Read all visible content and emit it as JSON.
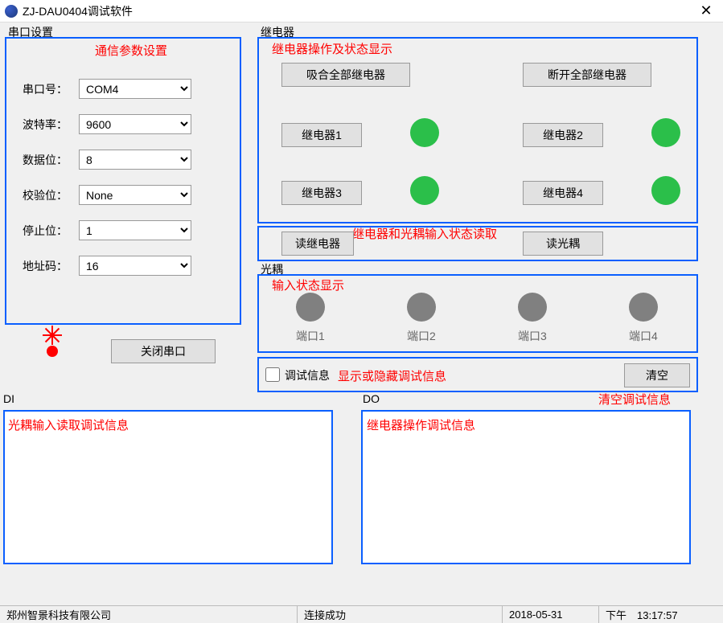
{
  "window": {
    "title": "ZJ-DAU0404调试软件"
  },
  "serial": {
    "group": "串口设置",
    "annot": "通信参数设置",
    "port_label": "串口号：",
    "port_value": "COM4",
    "baud_label": "波特率：",
    "baud_value": "9600",
    "data_label": "数据位：",
    "data_value": "8",
    "parity_label": "校验位：",
    "parity_value": "None",
    "stop_label": "停止位：",
    "stop_value": "1",
    "addr_label": "地址码：",
    "addr_value": "16",
    "close_btn": "关闭串口"
  },
  "relay": {
    "group": "继电器",
    "annot": "继电器操作及状态显示",
    "close_all": "吸合全部继电器",
    "open_all": "断开全部继电器",
    "r1": "继电器1",
    "r2": "继电器2",
    "r3": "继电器3",
    "r4": "继电器4"
  },
  "read": {
    "annot": "继电器和光耦输入状态读取",
    "read_relay": "读继电器",
    "read_opto": "读光耦"
  },
  "opto": {
    "group": "光耦",
    "annot": "输入状态显示",
    "p1": "端口1",
    "p2": "端口2",
    "p3": "端口3",
    "p4": "端口4"
  },
  "debug": {
    "chk_label": "调试信息",
    "annot": "显示或隐藏调试信息",
    "clear": "清空",
    "clear_annot": "清空调试信息"
  },
  "di": {
    "group": "DI",
    "annot": "光耦输入读取调试信息"
  },
  "do": {
    "group": "DO",
    "annot": "继电器操作调试信息"
  },
  "status": {
    "company": "郑州智景科技有限公司",
    "conn": "连接成功",
    "date": "2018-05-31",
    "time": "下午　13:17:57"
  }
}
